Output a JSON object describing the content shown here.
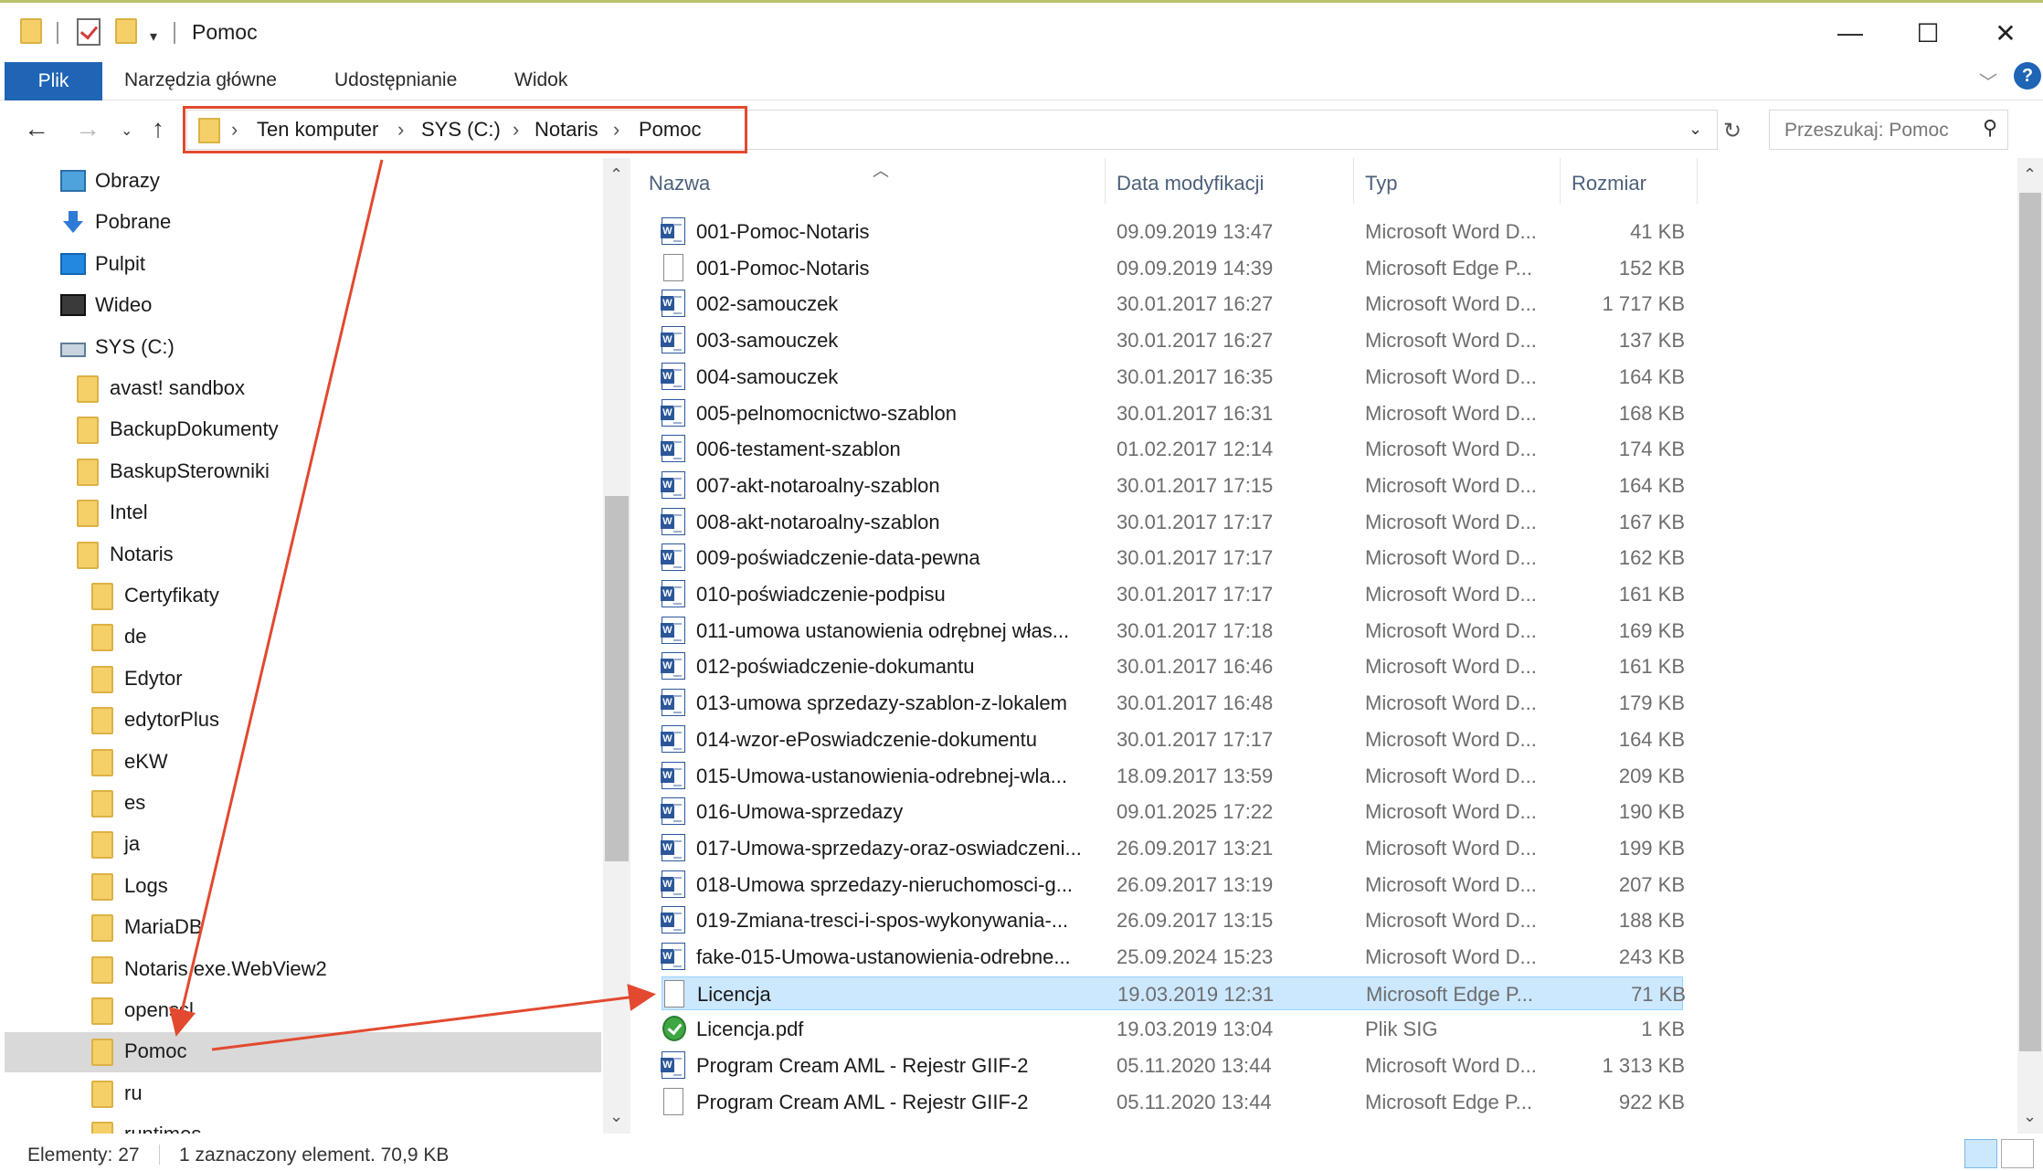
{
  "window": {
    "title": "Pomoc",
    "controls": {
      "minimize": "—",
      "maximize": "☐",
      "close": "✕"
    }
  },
  "ribbon": {
    "tabs": [
      "Plik",
      "Narzędzia główne",
      "Udostępnianie",
      "Widok"
    ],
    "help": "?"
  },
  "address": {
    "crumbs": [
      "Ten komputer",
      "SYS (C:)",
      "Notaris",
      "Pomoc"
    ],
    "separator": "›"
  },
  "search": {
    "placeholder": "Przeszukaj: Pomoc"
  },
  "tree": {
    "items": [
      {
        "label": "Obrazy",
        "icon": "pictures-icon"
      },
      {
        "label": "Pobrane",
        "icon": "downloads-icon"
      },
      {
        "label": "Pulpit",
        "icon": "desktop-icon"
      },
      {
        "label": "Wideo",
        "icon": "video-icon"
      },
      {
        "label": "SYS (C:)",
        "icon": "drive-icon"
      },
      {
        "label": "avast! sandbox",
        "icon": "folder-icon"
      },
      {
        "label": "BackupDokumenty",
        "icon": "folder-icon"
      },
      {
        "label": "BaskupSterowniki",
        "icon": "folder-icon"
      },
      {
        "label": "Intel",
        "icon": "folder-icon"
      },
      {
        "label": "Notaris",
        "icon": "folder-icon"
      },
      {
        "label": "Certyfikaty",
        "icon": "folder-icon"
      },
      {
        "label": "de",
        "icon": "folder-icon"
      },
      {
        "label": "Edytor",
        "icon": "folder-icon"
      },
      {
        "label": "edytorPlus",
        "icon": "folder-icon"
      },
      {
        "label": "eKW",
        "icon": "folder-icon"
      },
      {
        "label": "es",
        "icon": "folder-icon"
      },
      {
        "label": "ja",
        "icon": "folder-icon"
      },
      {
        "label": "Logs",
        "icon": "folder-icon"
      },
      {
        "label": "MariaDB",
        "icon": "folder-icon"
      },
      {
        "label": "Notaris.exe.WebView2",
        "icon": "folder-icon"
      },
      {
        "label": "openssl",
        "icon": "folder-icon"
      },
      {
        "label": "Pomoc",
        "icon": "folder-icon",
        "selected": true
      },
      {
        "label": "ru",
        "icon": "folder-icon"
      },
      {
        "label": "runtimes",
        "icon": "folder-icon"
      }
    ]
  },
  "columns": {
    "name": "Nazwa",
    "date": "Data modyfikacji",
    "type": "Typ",
    "size": "Rozmiar"
  },
  "files": [
    {
      "name": "001-Pomoc-Notaris",
      "date": "09.09.2019 13:47",
      "type": "Microsoft Word D...",
      "size": "41 KB",
      "icon": "word-document-icon"
    },
    {
      "name": "001-Pomoc-Notaris",
      "date": "09.09.2019 14:39",
      "type": "Microsoft Edge P...",
      "size": "152 KB",
      "icon": "blank-document-icon"
    },
    {
      "name": "002-samouczek",
      "date": "30.01.2017 16:27",
      "type": "Microsoft Word D...",
      "size": "1 717 KB",
      "icon": "word-document-icon"
    },
    {
      "name": "003-samouczek",
      "date": "30.01.2017 16:27",
      "type": "Microsoft Word D...",
      "size": "137 KB",
      "icon": "word-document-icon"
    },
    {
      "name": "004-samouczek",
      "date": "30.01.2017 16:35",
      "type": "Microsoft Word D...",
      "size": "164 KB",
      "icon": "word-document-icon"
    },
    {
      "name": "005-pelnomocnictwo-szablon",
      "date": "30.01.2017 16:31",
      "type": "Microsoft Word D...",
      "size": "168 KB",
      "icon": "word-document-icon"
    },
    {
      "name": "006-testament-szablon",
      "date": "01.02.2017 12:14",
      "type": "Microsoft Word D...",
      "size": "174 KB",
      "icon": "word-document-icon"
    },
    {
      "name": "007-akt-notaroalny-szablon",
      "date": "30.01.2017 17:15",
      "type": "Microsoft Word D...",
      "size": "164 KB",
      "icon": "word-document-icon"
    },
    {
      "name": "008-akt-notaroalny-szablon",
      "date": "30.01.2017 17:17",
      "type": "Microsoft Word D...",
      "size": "167 KB",
      "icon": "word-document-icon"
    },
    {
      "name": "009-poświadczenie-data-pewna",
      "date": "30.01.2017 17:17",
      "type": "Microsoft Word D...",
      "size": "162 KB",
      "icon": "word-document-icon"
    },
    {
      "name": "010-poświadczenie-podpisu",
      "date": "30.01.2017 17:17",
      "type": "Microsoft Word D...",
      "size": "161 KB",
      "icon": "word-document-icon"
    },
    {
      "name": "011-umowa ustanowienia odrębnej włas...",
      "date": "30.01.2017 17:18",
      "type": "Microsoft Word D...",
      "size": "169 KB",
      "icon": "word-document-icon"
    },
    {
      "name": "012-poświadczenie-dokumantu",
      "date": "30.01.2017 16:46",
      "type": "Microsoft Word D...",
      "size": "161 KB",
      "icon": "word-document-icon"
    },
    {
      "name": "013-umowa sprzedazy-szablon-z-lokalem",
      "date": "30.01.2017 16:48",
      "type": "Microsoft Word D...",
      "size": "179 KB",
      "icon": "word-document-icon"
    },
    {
      "name": "014-wzor-ePoswiadczenie-dokumentu",
      "date": "30.01.2017 17:17",
      "type": "Microsoft Word D...",
      "size": "164 KB",
      "icon": "word-document-icon"
    },
    {
      "name": "015-Umowa-ustanowienia-odrebnej-wla...",
      "date": "18.09.2017 13:59",
      "type": "Microsoft Word D...",
      "size": "209 KB",
      "icon": "word-document-icon"
    },
    {
      "name": "016-Umowa-sprzedazy",
      "date": "09.01.2025 17:22",
      "type": "Microsoft Word D...",
      "size": "190 KB",
      "icon": "word-document-icon"
    },
    {
      "name": "017-Umowa-sprzedazy-oraz-oswiadczeni...",
      "date": "26.09.2017 13:21",
      "type": "Microsoft Word D...",
      "size": "199 KB",
      "icon": "word-document-icon"
    },
    {
      "name": "018-Umowa sprzedazy-nieruchomosci-g...",
      "date": "26.09.2017 13:19",
      "type": "Microsoft Word D...",
      "size": "207 KB",
      "icon": "word-document-icon"
    },
    {
      "name": "019-Zmiana-tresci-i-spos-wykonywania-...",
      "date": "26.09.2017 13:15",
      "type": "Microsoft Word D...",
      "size": "188 KB",
      "icon": "word-document-icon"
    },
    {
      "name": "fake-015-Umowa-ustanowienia-odrebne...",
      "date": "25.09.2024 15:23",
      "type": "Microsoft Word D...",
      "size": "243 KB",
      "icon": "word-document-icon"
    },
    {
      "name": "Licencja",
      "date": "19.03.2019 12:31",
      "type": "Microsoft Edge P...",
      "size": "71 KB",
      "icon": "blank-document-icon",
      "selected": true
    },
    {
      "name": "Licencja.pdf",
      "date": "19.03.2019 13:04",
      "type": "Plik SIG",
      "size": "1 KB",
      "icon": "signature-file-icon"
    },
    {
      "name": "Program Cream AML - Rejestr GIIF-2",
      "date": "05.11.2020 13:44",
      "type": "Microsoft Word D...",
      "size": "1 313 KB",
      "icon": "word-document-icon"
    },
    {
      "name": "Program Cream AML - Rejestr GIIF-2",
      "date": "05.11.2020 13:44",
      "type": "Microsoft Edge P...",
      "size": "922 KB",
      "icon": "blank-document-icon"
    }
  ],
  "status": {
    "count": "Elementy: 27",
    "selection": "1 zaznaczony element. 70,9 KB"
  },
  "colors": {
    "accent": "#1f64b5",
    "annotation": "#e2492f",
    "selection": "#cce8ff",
    "folder": "#f5d069"
  }
}
